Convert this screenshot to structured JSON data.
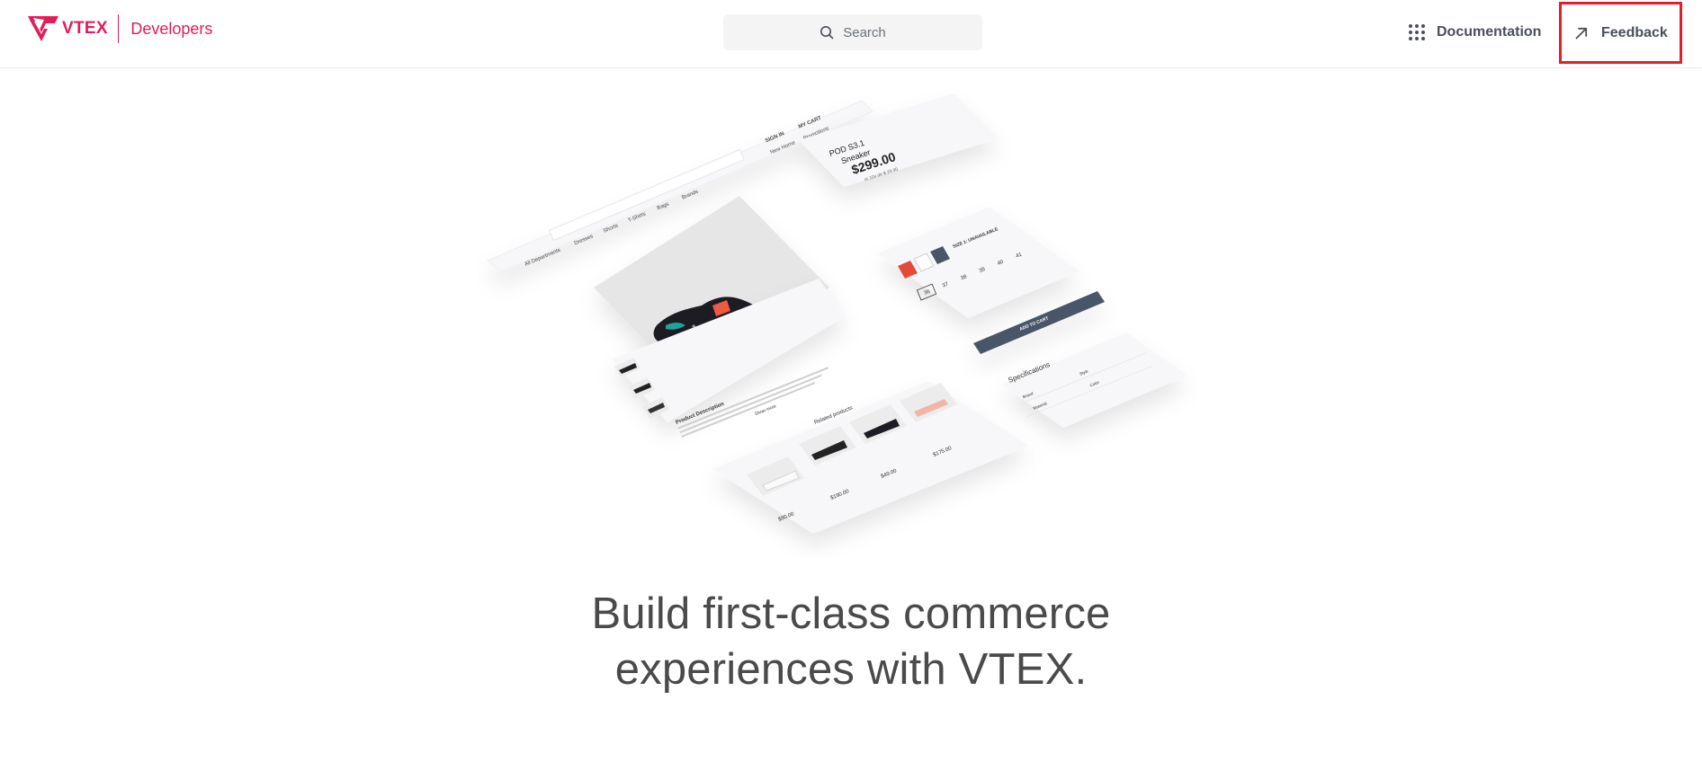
{
  "header": {
    "brand": "VTEX",
    "product": "Developers",
    "search": {
      "placeholder": "Search",
      "icon": "search-icon"
    },
    "nav": {
      "documentation": {
        "label": "Documentation",
        "icon": "grid-dots-icon"
      },
      "feedback": {
        "label": "Feedback",
        "icon": "arrow-up-right-icon"
      }
    }
  },
  "hero_illustration": {
    "store_nav": {
      "departments": "All Departments",
      "menu": [
        "Dresses",
        "Shorts",
        "T-Shirts",
        "Bags",
        "Brands"
      ],
      "sign_in": "SIGN IN",
      "cart": "MY CART",
      "links": [
        "New Home",
        "Promotions"
      ]
    },
    "product": {
      "name_line1": "POD S3.1",
      "name_line2": "Sneaker",
      "price": "$299.00",
      "installments": "or 10x de $ 29.90"
    },
    "sku": {
      "size_note": "SIZE 1: UNAVAILABLE",
      "sizes": [
        "36",
        "37",
        "38",
        "39",
        "40",
        "41"
      ]
    },
    "add_to_cart": "ADD TO CART",
    "description_title": "Product Description",
    "show_more": "Show more",
    "specifications_title": "Specifications",
    "spec_labels": [
      "Brand",
      "Material",
      "Style",
      "Color"
    ],
    "related_title": "Related products",
    "related_prices": [
      "$90.00",
      "$190.00",
      "$49.00",
      "$175.00"
    ]
  },
  "headline": {
    "line1": "Build first-class commerce",
    "line2": "experiences with VTEX."
  },
  "colors": {
    "brand": "#e31c58",
    "highlight_border": "#e2202a",
    "text": "#4a4a4a",
    "button_dark": "#4a5568"
  }
}
